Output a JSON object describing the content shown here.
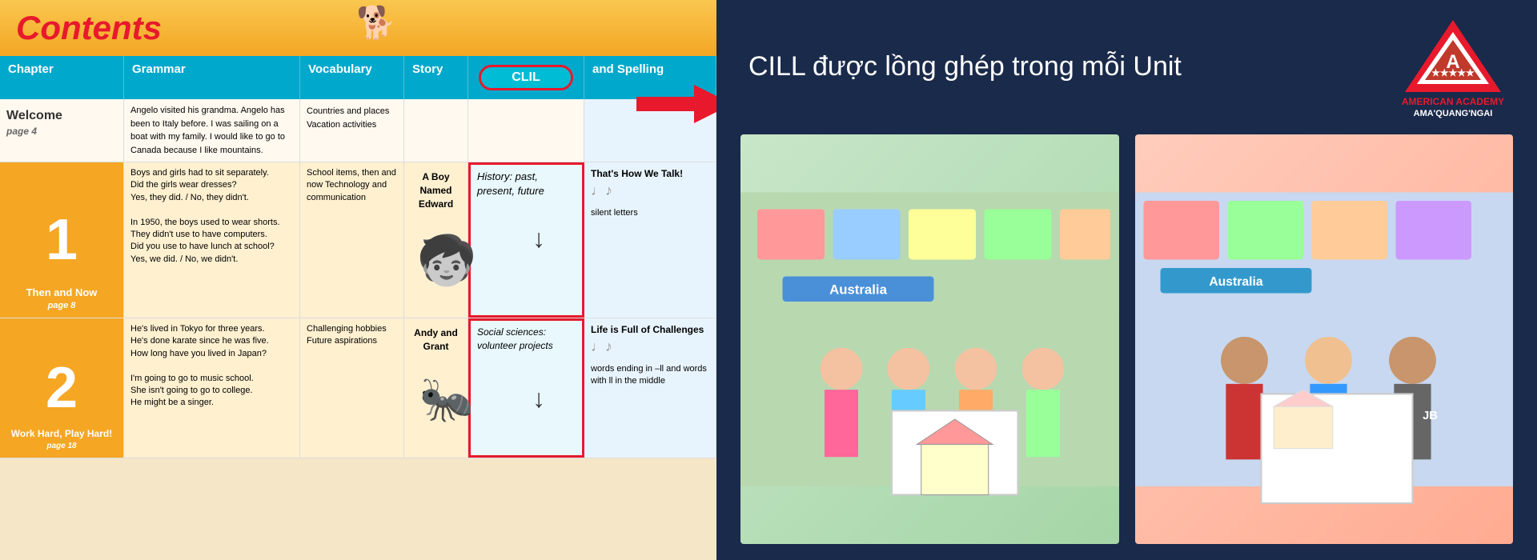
{
  "header": {
    "title": "Contents"
  },
  "table": {
    "columns": [
      "Chapter",
      "Grammar",
      "Vocabulary",
      "Story",
      "CLIL",
      "and Spelling"
    ],
    "welcome": {
      "chapter": "Welcome",
      "page": "page 4",
      "grammar": "Angelo visited his grandma.\nAngelo has been to Italy before.\nI was sailing on a boat with my family.\nI would like to go to Canada because I like mountains.",
      "vocabulary": "Countries and places\nVacation activities",
      "story": "",
      "clil": "",
      "spelling": ""
    },
    "ch1": {
      "number": "1",
      "label": "Then and Now",
      "page": "page 8",
      "grammar": "Boys and girls had to sit separately.\nDid the girls wear dresses?\nYes, they did. / No, they didn't.\n\nIn 1950, the boys used to wear shorts.\nThey didn't use to have computers.\nDid you use to have lunch at school?\nYes, we did. / No, we didn't.",
      "vocabulary": "School items, then and now\nTechnology and communication",
      "story_title": "A Boy Named Edward",
      "clil": "History: past, present, future",
      "audio": "That's How We Talk!",
      "spelling": "silent letters"
    },
    "ch2": {
      "number": "2",
      "label": "Work Hard, Play Hard!",
      "page": "page 18",
      "grammar": "He's lived in Tokyo for three years.\nHe's done karate since he was five.\nHow long have you lived in Japan?\n\nI'm going to go to music school.\nShe isn't going to go to college.\nHe might be a singer.",
      "vocabulary": "Challenging hobbies\nFuture aspirations",
      "story_title": "Andy and Grant",
      "clil": "Social sciences: volunteer projects",
      "audio": "Life is Full of Challenges",
      "spelling": "words ending in –ll and words with ll in the middle"
    }
  },
  "right_panel": {
    "heading": "CILL được lồng ghép trong mỗi Unit",
    "logo_line1": "AMERICAN ACADEMY",
    "logo_line2": "AMA'QUANG'NGAI"
  },
  "icons": {
    "dog": "🐕",
    "music_notes": "♩♪",
    "arrow_down": "↓",
    "ant_char": "🐜",
    "boy_char": "👦"
  }
}
